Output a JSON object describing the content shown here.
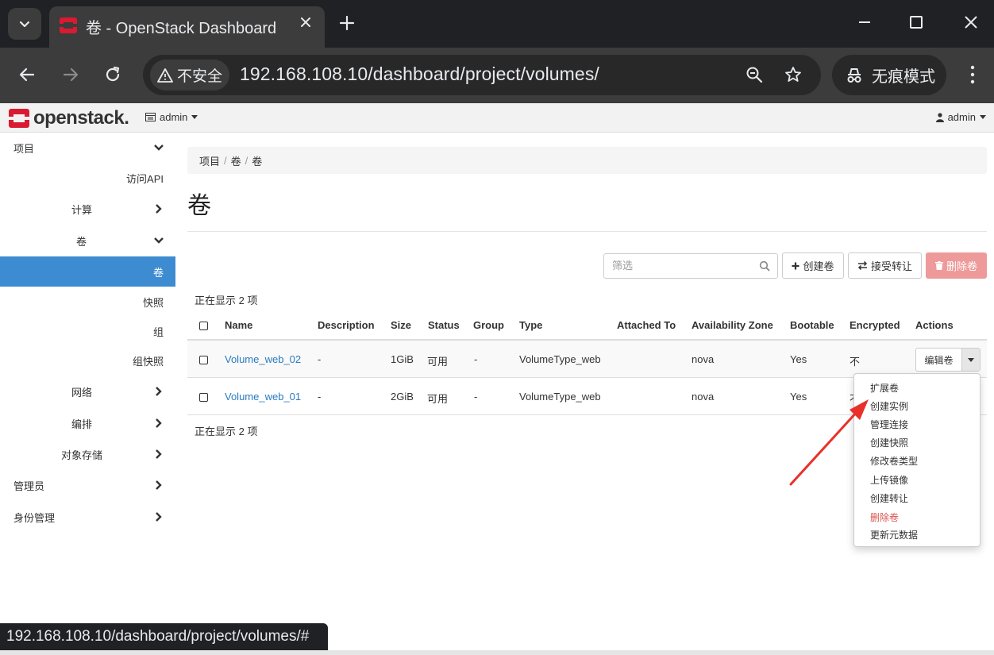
{
  "browser": {
    "tab_title": "卷 - OpenStack Dashboard",
    "security_label": "不安全",
    "url": "192.168.108.10/dashboard/project/volumes/",
    "incognito_label": "无痕模式",
    "status_url": "192.168.108.10/dashboard/project/volumes/#"
  },
  "navbar": {
    "logo_text": "openstack.",
    "project": "admin",
    "user": "admin"
  },
  "sidebar": {
    "project": "项目",
    "api_access": "访问API",
    "compute": "计算",
    "volumes": "卷",
    "volumes_active": "卷",
    "snapshots": "快照",
    "groups": "组",
    "group_snapshots": "组快照",
    "network": "网络",
    "orchestration": "编排",
    "object_store": "对象存储",
    "admin": "管理员",
    "identity": "身份管理"
  },
  "breadcrumb": [
    "项目",
    "卷",
    "卷"
  ],
  "page_title": "卷",
  "toolbar": {
    "filter_placeholder": "筛选",
    "create_label": "创建卷",
    "accept_transfer_label": "接受转让",
    "delete_label": "删除卷"
  },
  "count_text": "正在显示 2 项",
  "table": {
    "headers": [
      "Name",
      "Description",
      "Size",
      "Status",
      "Group",
      "Type",
      "Attached To",
      "Availability Zone",
      "Bootable",
      "Encrypted",
      "Actions"
    ],
    "rows": [
      {
        "name": "Volume_web_02",
        "description": "-",
        "size": "1GiB",
        "status": "可用",
        "group": "-",
        "type": "VolumeType_web",
        "attached": "",
        "zone": "nova",
        "bootable": "Yes",
        "encrypted": "不"
      },
      {
        "name": "Volume_web_01",
        "description": "-",
        "size": "2GiB",
        "status": "可用",
        "group": "-",
        "type": "VolumeType_web",
        "attached": "",
        "zone": "nova",
        "bootable": "Yes",
        "encrypted": "不"
      }
    ]
  },
  "row_action": {
    "edit_label": "编辑卷",
    "menu": [
      "扩展卷",
      "创建实例",
      "管理连接",
      "创建快照",
      "修改卷类型",
      "上传镜像",
      "创建转让",
      "删除卷",
      "更新元数据"
    ]
  },
  "colors": {
    "accent": "#3d8bd1",
    "link": "#2a7ac0",
    "danger": "#d9534f",
    "logo_red": "#da1a32",
    "annotation_arrow": "#e8312a"
  }
}
